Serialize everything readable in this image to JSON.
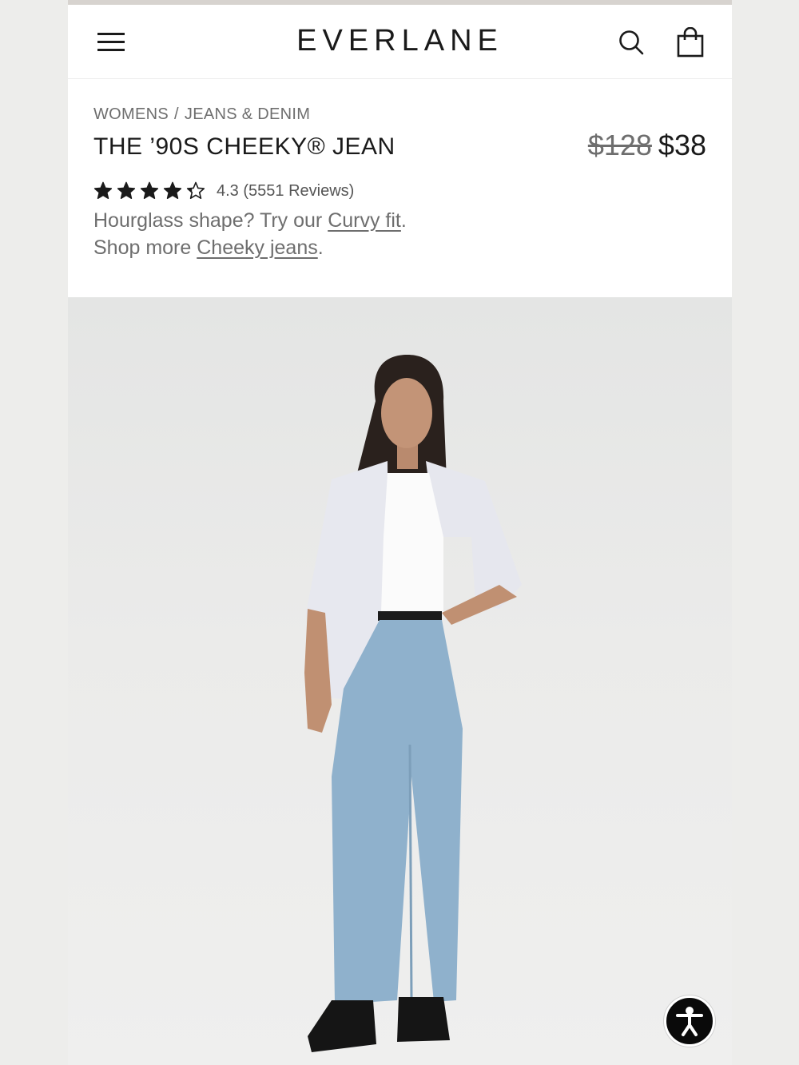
{
  "header": {
    "logo": "EVERLANE",
    "menu_icon": "hamburger-menu-icon",
    "search_icon": "search-icon",
    "bag_icon": "shopping-bag-icon"
  },
  "breadcrumb": {
    "items": [
      "WOMENS",
      "JEANS & DENIM"
    ],
    "separator": "/"
  },
  "product": {
    "title": "THE ’90S CHEEKY® JEAN",
    "original_price": "$128",
    "sale_price": "$38",
    "rating_value": 4.3,
    "rating_out_of": 5,
    "rating_text": "4.3 (5551 Reviews)",
    "promo_line1_prefix": "Hourglass shape? Try our ",
    "promo_line1_link": "Curvy fit",
    "promo_line1_suffix": ".",
    "promo_line2_prefix": "Shop more ",
    "promo_line2_link": "Cheeky jeans",
    "promo_line2_suffix": "."
  },
  "hero_image": {
    "subject": "model-wearing-light-wash-jeans"
  },
  "accessibility": {
    "icon": "accessibility-person-icon"
  },
  "colors": {
    "text": "#1a1a1a",
    "muted": "#6e6e6e",
    "denim": "#8fb1cc",
    "background": "#ffffff"
  }
}
